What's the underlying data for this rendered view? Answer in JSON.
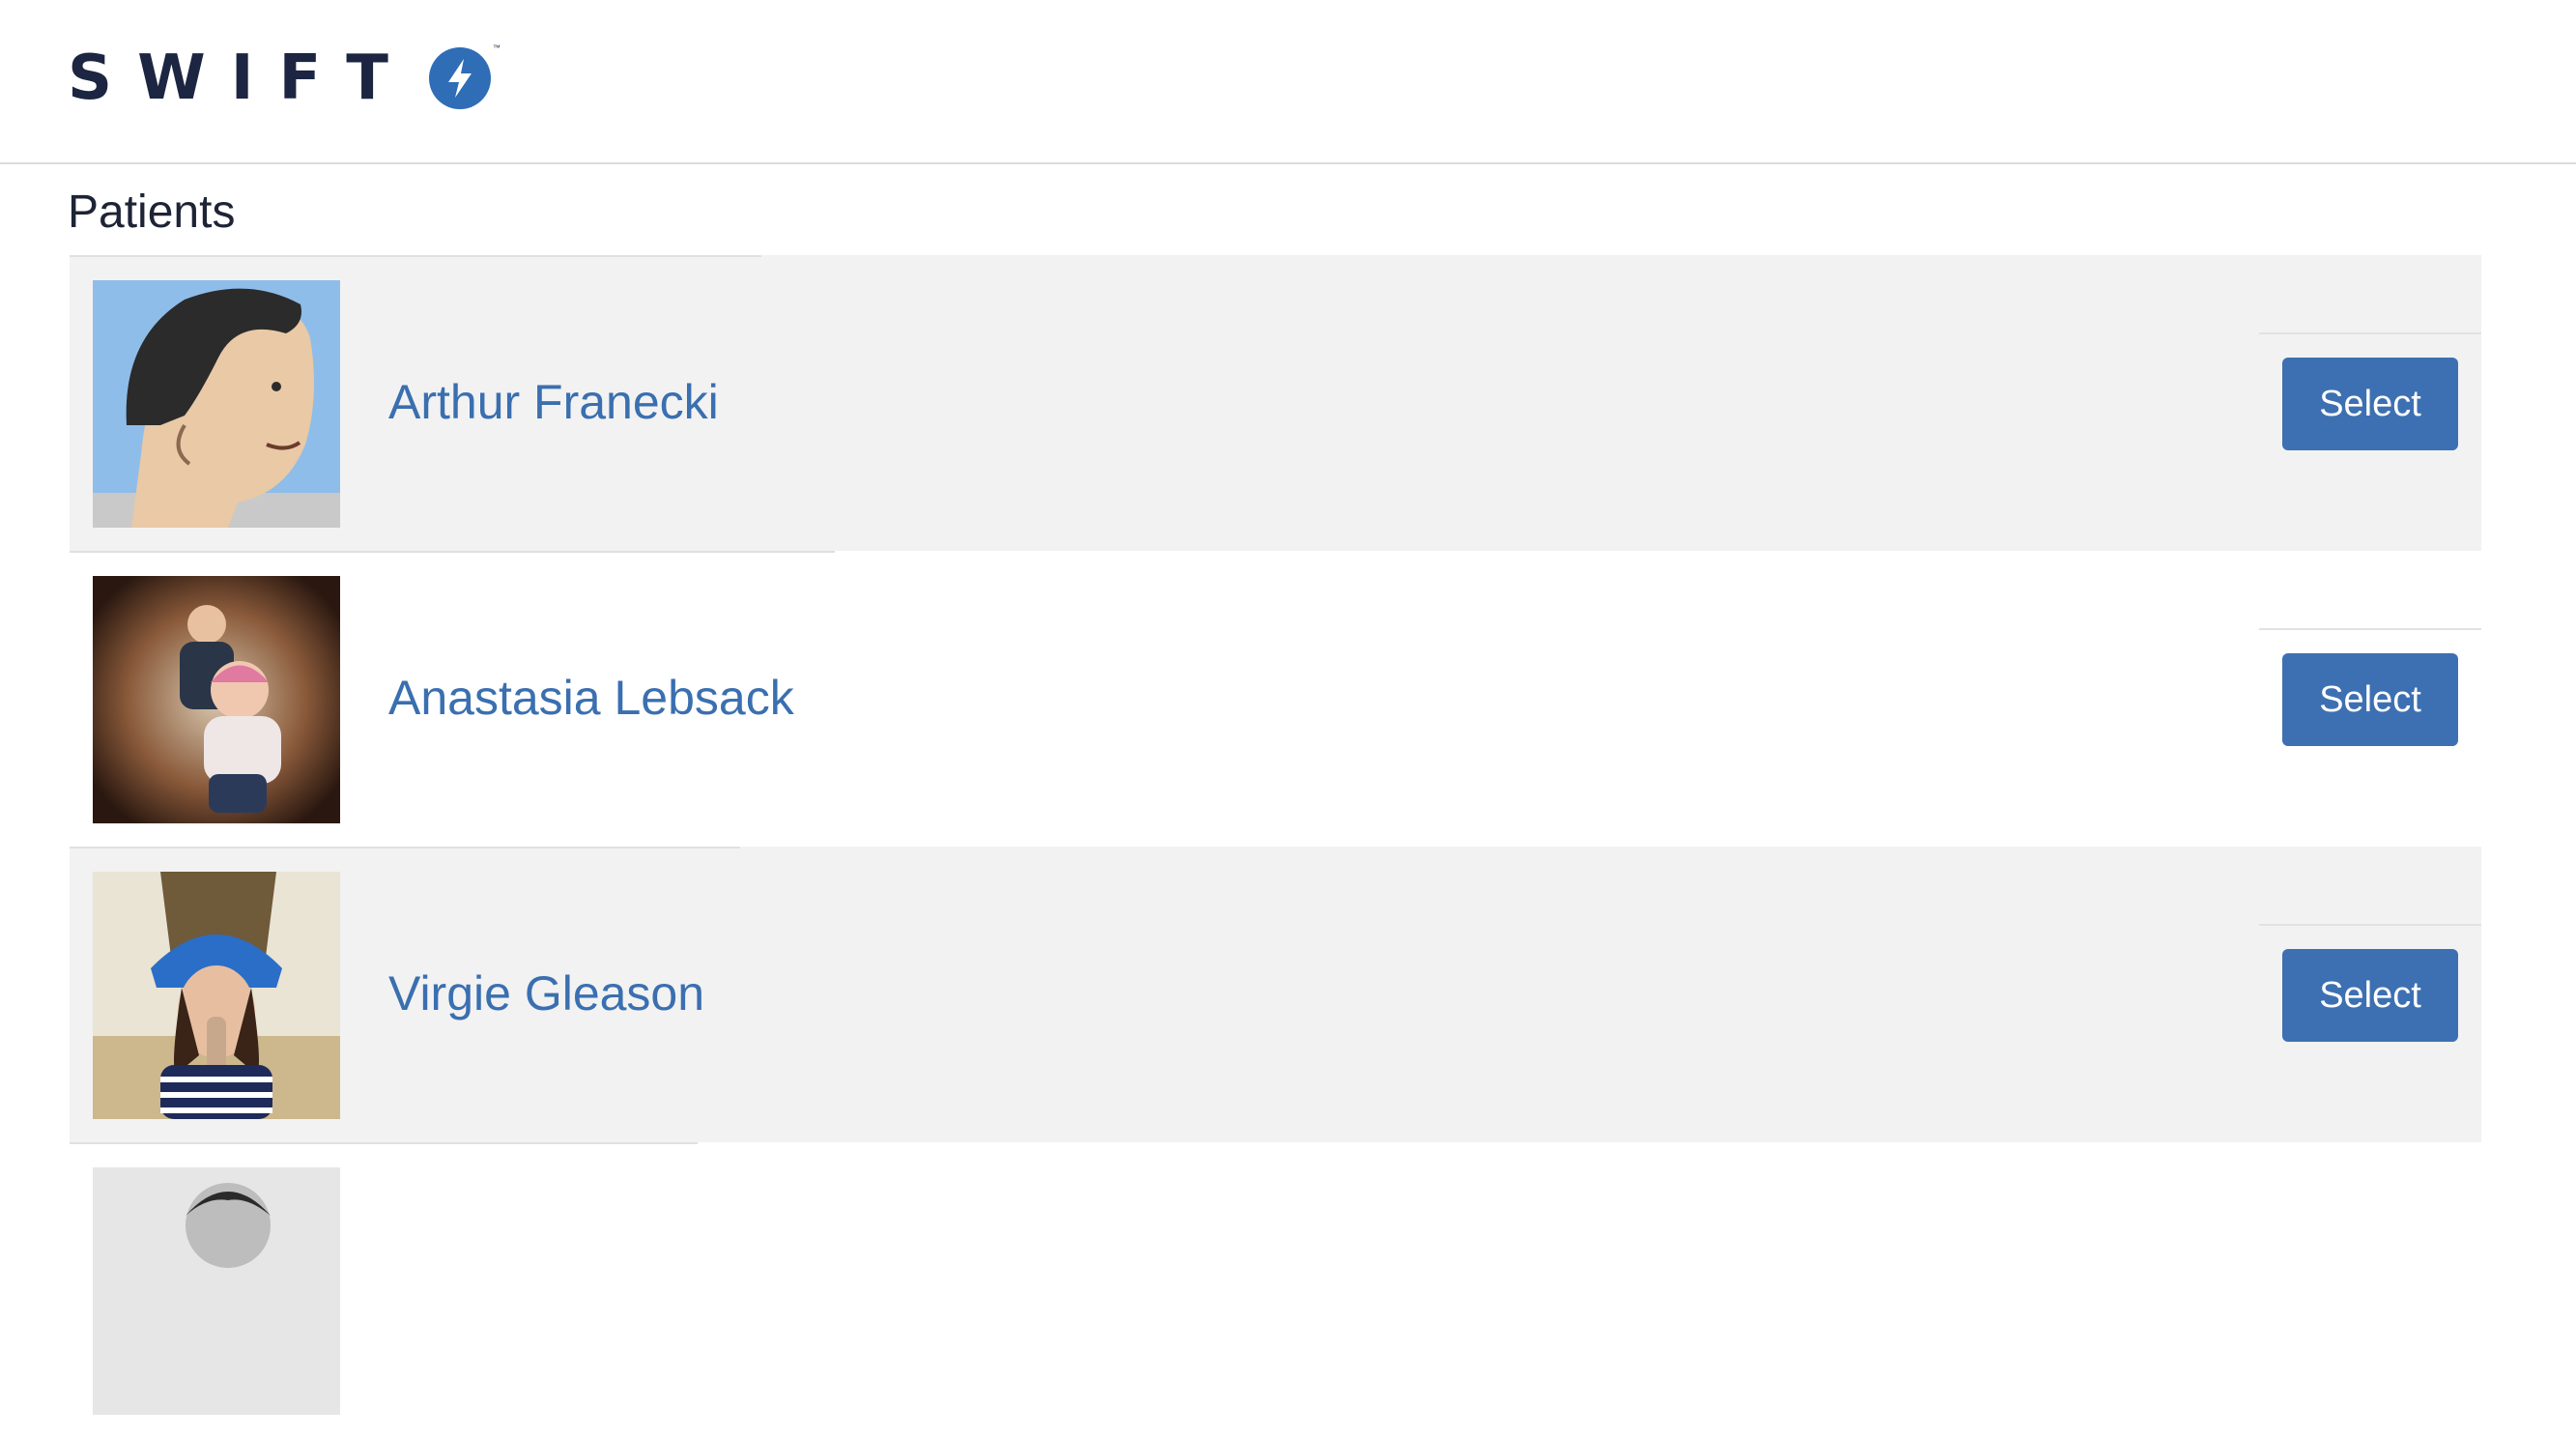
{
  "brand": {
    "logo_text": "SWIFT",
    "logo_mark": "™",
    "logo_icon": "lightning-bolt-icon",
    "accent_color": "#2f6db6",
    "text_color": "#1c2541"
  },
  "page": {
    "title": "Patients"
  },
  "patients": [
    {
      "name": "Arthur Franecki",
      "select_label": "Select",
      "avatar": "avatar-photo"
    },
    {
      "name": "Anastasia Lebsack",
      "select_label": "Select",
      "avatar": "avatar-photo"
    },
    {
      "name": "Virgie Gleason",
      "select_label": "Select",
      "avatar": "avatar-photo"
    },
    {
      "name": "",
      "select_label": "",
      "avatar": "avatar-photo"
    }
  ],
  "colors": {
    "link": "#3a6fb0",
    "button": "#3d70b2",
    "row_shade": "#f2f2f2"
  }
}
